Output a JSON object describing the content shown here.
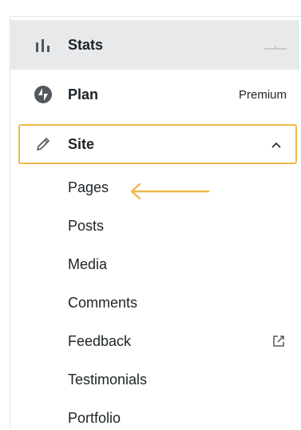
{
  "colors": {
    "highlight_border": "#f0b849",
    "arrow": "#f0b849",
    "selected_bg": "#e8e9eb",
    "text": "#1d2327",
    "icon": "#50575e"
  },
  "menu": {
    "stats": {
      "label": "Stats",
      "icon": "bar-chart-icon"
    },
    "plan": {
      "label": "Plan",
      "badge": "Premium",
      "icon": "jetpack-bolt-icon"
    },
    "site": {
      "label": "Site",
      "icon": "pencil-icon",
      "expanded": true
    }
  },
  "submenu": [
    {
      "label": "Pages"
    },
    {
      "label": "Posts"
    },
    {
      "label": "Media"
    },
    {
      "label": "Comments"
    },
    {
      "label": "Feedback",
      "external": true
    },
    {
      "label": "Testimonials"
    },
    {
      "label": "Portfolio"
    }
  ]
}
